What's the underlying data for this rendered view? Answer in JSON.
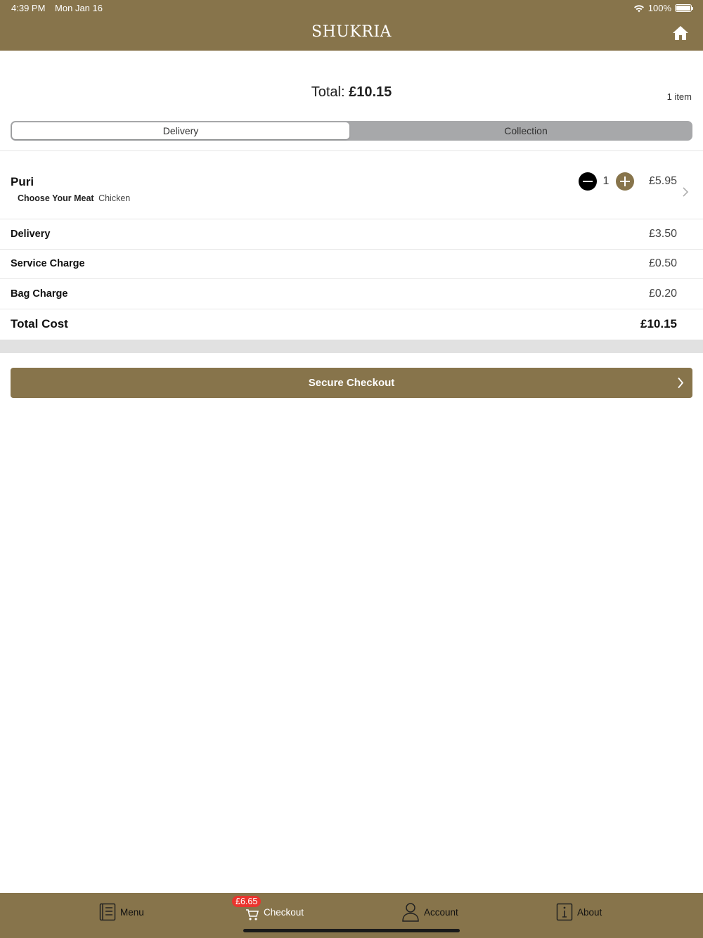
{
  "status_bar": {
    "time": "4:39 PM",
    "date": "Mon Jan 16",
    "battery": "100%"
  },
  "header": {
    "brand": "Shukria"
  },
  "summary": {
    "total_label": "Total:",
    "total_value": "£10.15",
    "item_count": "1 item"
  },
  "order_type": {
    "options": [
      "Delivery",
      "Collection"
    ],
    "selected": "Delivery"
  },
  "basket": {
    "items": [
      {
        "name": "Puri",
        "option_label": "Choose Your Meat",
        "option_value": "Chicken",
        "quantity": "1",
        "price": "£5.95"
      }
    ]
  },
  "charges": [
    {
      "label": "Delivery",
      "value": "£3.50"
    },
    {
      "label": "Service Charge",
      "value": "£0.50"
    },
    {
      "label": "Bag Charge",
      "value": "£0.20"
    }
  ],
  "total_cost": {
    "label": "Total Cost",
    "value": "£10.15"
  },
  "checkout_button": {
    "label": "Secure Checkout"
  },
  "tabbar": {
    "tabs": [
      {
        "label": "Menu",
        "icon": "menu-book-icon"
      },
      {
        "label": "Checkout",
        "icon": "cart-icon"
      },
      {
        "label": "Account",
        "icon": "person-icon"
      },
      {
        "label": "About",
        "icon": "info-icon"
      }
    ],
    "cart_badge": "£6.65"
  },
  "colors": {
    "brand": "#87744b",
    "badge": "#e9352e",
    "segment_bg": "#a7a8aa"
  }
}
